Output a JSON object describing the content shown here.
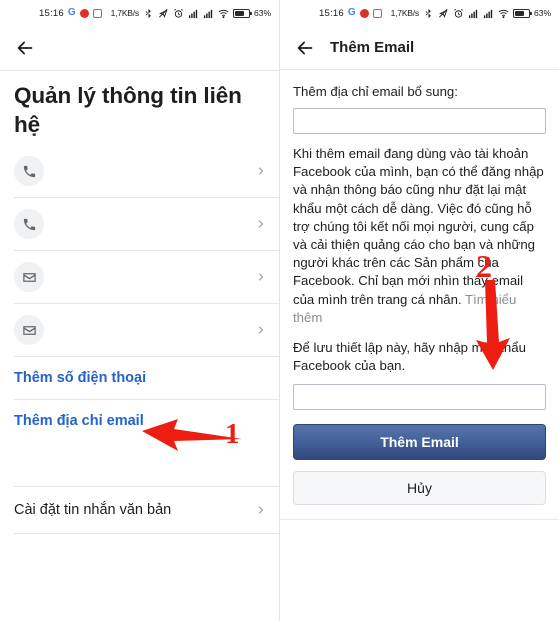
{
  "status_bar": {
    "time": "15:16",
    "google_icon": "G",
    "app_icon_1": "app-red-icon",
    "app_icon_2": "app-orange-icon",
    "network_speed": "1,7KB/s",
    "bluetooth_icon": "bluetooth-icon",
    "location_off_icon": "location-off-icon",
    "alarm_icon": "alarm-icon",
    "signal_1_icon": "signal-bars-icon",
    "signal_2_icon": "signal-bars-icon",
    "wifi_icon": "wifi-icon",
    "battery_icon": "battery-icon",
    "battery_percent": "63%"
  },
  "left_screen": {
    "back_icon": "back-arrow-icon",
    "title": "Quản lý thông tin liên hệ",
    "contact_rows": [
      {
        "icon": "phone-icon",
        "value_redacted": true,
        "chevron": "chevron-right-icon"
      },
      {
        "icon": "phone-icon",
        "value_redacted": true,
        "chevron": "chevron-right-icon"
      },
      {
        "icon": "email-icon",
        "value_redacted": true,
        "chevron": "chevron-right-icon"
      },
      {
        "icon": "email-icon",
        "value_redacted": true,
        "chevron": "chevron-right-icon"
      }
    ],
    "add_phone_label": "Thêm số điện thoại",
    "add_email_label": "Thêm địa chỉ email",
    "text_message_settings_label": "Cài đặt tin nhắn văn bản",
    "link_color": "#2563c9"
  },
  "right_screen": {
    "back_icon": "back-arrow-icon",
    "title": "Thêm Email",
    "field_label": "Thêm địa chỉ email bổ sung:",
    "email_input_value": "",
    "email_input_placeholder": "",
    "paragraph": "Khi thêm email đang dùng vào tài khoản Facebook của mình, bạn có thể đăng nhập và nhận thông báo cũng như đặt lại mật khẩu một cách dễ dàng. Việc đó cũng hỗ trợ chúng tôi kết nối mọi người, cung cấp và cải thiện quảng cáo cho bạn và những người khác trên các Sản phẩm của Facebook. Chỉ bạn mới nhìn thấy email của mình trên trang cá nhân. ",
    "learn_more_label": "Tìm hiểu thêm",
    "password_note": "Để lưu thiết lập này, hãy nhập mật khẩu Facebook của bạn.",
    "password_input_value": "",
    "password_input_placeholder": "",
    "submit_label": "Thêm Email",
    "cancel_label": "Hủy",
    "submit_color": "#3b5998"
  },
  "annotations": {
    "marker_1_label": "1",
    "marker_1_target": "Thêm địa chỉ email",
    "marker_2_label": "2",
    "marker_2_target": "Thêm Email",
    "arrow_color": "#ee1d11"
  }
}
